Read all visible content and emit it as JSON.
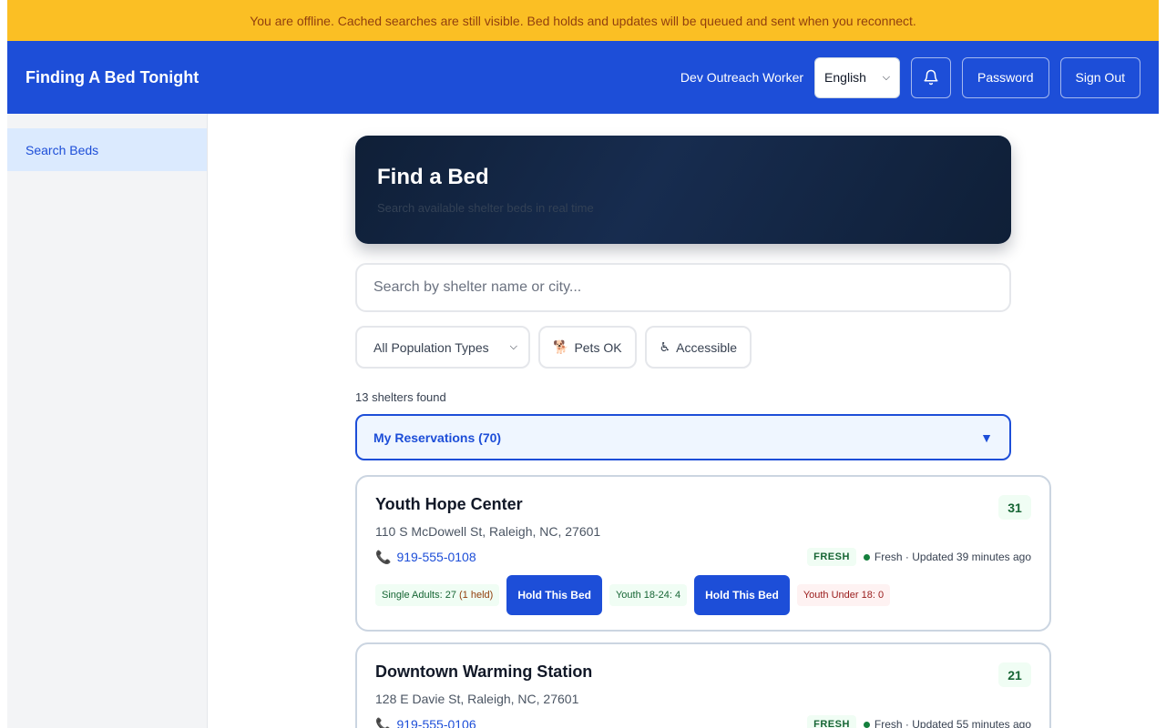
{
  "banner": {
    "offline_text": "You are offline. Cached searches are still visible. Bed holds and updates will be queued and sent when you reconnect."
  },
  "header": {
    "app_title": "Finding A Bed Tonight",
    "user_name": "Dev Outreach Worker",
    "language": "English",
    "password_label": "Password",
    "signout_label": "Sign Out"
  },
  "sidebar": {
    "items": [
      {
        "label": "Search Beds",
        "active": true
      }
    ]
  },
  "hero": {
    "title": "Find a Bed",
    "subtitle": "Search available shelter beds in real time"
  },
  "search": {
    "placeholder": "Search by shelter name or city..."
  },
  "filters": {
    "population_selected": "All Population Types",
    "pets_label": "Pets OK",
    "pets_icon": "🐕",
    "accessible_label": "Accessible",
    "accessible_icon": "♿"
  },
  "results": {
    "found_text": "13 shelters found",
    "reservations_label": "My Reservations (70)",
    "reservations_arrow": "▼"
  },
  "shelters": [
    {
      "name": "Youth Hope Center",
      "count": "31",
      "address": "110 S McDowell St, Raleigh, NC, 27601",
      "phone": "919-555-0108",
      "fresh_badge": "FRESH",
      "fresh_status": "Fresh · Updated 39 minutes ago",
      "beds": {
        "single_adults": "Single Adults: 27",
        "single_adults_held": "(1 held)",
        "hold_label_1": "Hold This Bed",
        "youth_18_24": "Youth 18-24: 4",
        "hold_label_2": "Hold This Bed",
        "youth_under_18": "Youth Under 18: 0"
      }
    },
    {
      "name": "Downtown Warming Station",
      "count": "21",
      "address": "128 E Davie St, Raleigh, NC, 27601",
      "phone": "919-555-0106",
      "fresh_badge": "FRESH",
      "fresh_status": "Fresh · Updated 55 minutes ago"
    }
  ]
}
